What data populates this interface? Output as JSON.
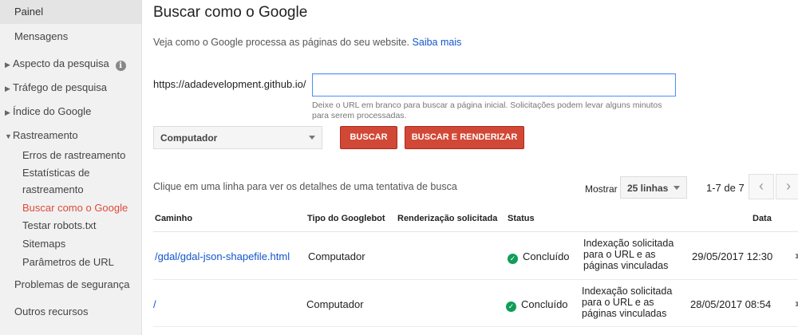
{
  "sidebar": {
    "painel": "Painel",
    "mensagens": "Mensagens",
    "aspecto": "Aspecto da pesquisa",
    "trafego": "Tráfego de pesquisa",
    "indice": "Índice do Google",
    "rastreamento": "Rastreamento",
    "sub": {
      "erros": "Erros de rastreamento",
      "estatisticas_1": "Estatísticas de",
      "estatisticas_2": "rastreamento",
      "buscar": "Buscar como o Google",
      "robots": "Testar robots.txt",
      "sitemaps": "Sitemaps",
      "parametros": "Parâmetros de URL"
    },
    "seguranca": "Problemas de segurança",
    "outros": "Outros recursos"
  },
  "main": {
    "title": "Buscar como o Google",
    "subtitle": "Veja como o Google processa as páginas do seu website.",
    "saiba_mais": "Saiba mais",
    "url_prefix": "https://adadevelopment.github.io/",
    "url_value": "",
    "hint": "Deixe o URL em branco para buscar a página inicial. Solicitações podem levar alguns minutos para serem processadas.",
    "device_select": "Computador",
    "buscar_button": "BUSCAR",
    "buscar_renderizar_button": "BUSCAR E RENDERIZAR",
    "instructions": "Clique em uma linha para ver os detalhes de uma tentativa de busca",
    "mostrar_label": "Mostrar",
    "mostrar_value": "25 linhas",
    "pager_count": "1-7 de 7"
  },
  "table": {
    "headers": {
      "caminho": "Caminho",
      "tipo": "Tipo do Googlebot",
      "renderizacao": "Renderização solicitada",
      "status": "Status",
      "data": "Data"
    },
    "rows": [
      {
        "caminho": "/gdal/gdal-json-shapefile.html",
        "tipo": "Computador",
        "status": "Concluído",
        "indexacao": "Indexação solicitada para o URL e as páginas vinculadas",
        "data": "29/05/2017 12:30"
      },
      {
        "caminho": "/",
        "tipo": "Computador",
        "status": "Concluído",
        "indexacao": "Indexação solicitada para o URL e as páginas vinculadas",
        "data": "28/05/2017 08:54"
      }
    ]
  },
  "colors": {
    "accent_red": "#d14836",
    "active_nav": "#dd4b39",
    "link": "#1155cc",
    "success": "#0f9d58"
  },
  "icons": [
    "info-icon",
    "triangle-right-icon",
    "triangle-down-icon",
    "chevron-left-icon",
    "chevron-right-icon",
    "check-circle-icon",
    "double-chevron-right-icon",
    "dropdown-arrow-icon"
  ]
}
